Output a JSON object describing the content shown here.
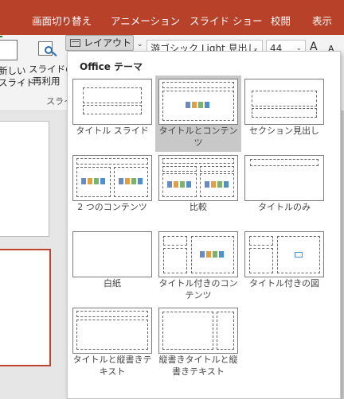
{
  "tabs": [
    "画面切り替え",
    "アニメーション",
    "スライド ショー",
    "校閲",
    "表示"
  ],
  "ribbon": {
    "new_slide_line1": "新しい",
    "new_slide_line2": "スライド",
    "new_slide_caret": "⌄",
    "reuse_line1": "スライドの",
    "reuse_line2": "再利用",
    "group_label": "スライ",
    "layout_label": "レイアウト",
    "layout_caret": "⌄",
    "font_name": "游ゴシック Light 見出し",
    "font_size": "44",
    "grow_icon": "A",
    "shrink_icon": "A"
  },
  "gallery": {
    "title": "Office テーマ",
    "items": [
      "タイトル スライド",
      "タイトルとコンテンツ",
      "セクション見出し",
      "2 つのコンテンツ",
      "比較",
      "タイトルのみ",
      "白紙",
      "タイトル付きのコンテンツ",
      "タイトル付きの図",
      "タイトルと縦書きテキスト",
      "縦書きタイトルと縦書きテキスト"
    ],
    "selected_index": 1
  },
  "colors": {
    "tab_bar": "#b8412a",
    "selected_item": "#c8c8c8",
    "current_slide_border": "#c0452c"
  }
}
